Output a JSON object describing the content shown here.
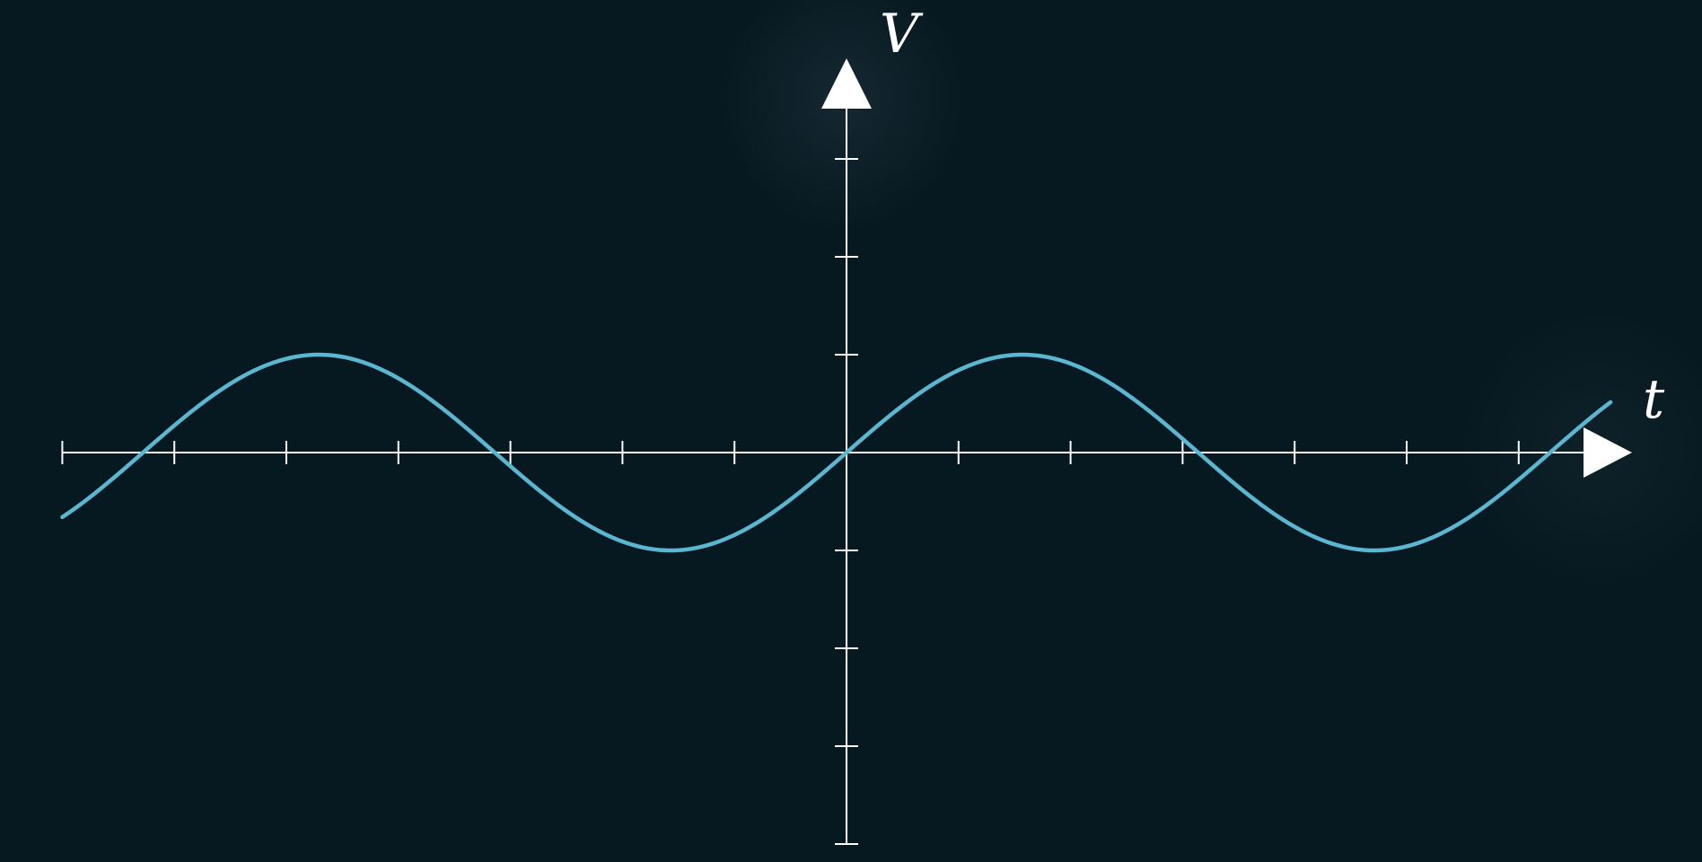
{
  "chart_data": {
    "type": "line",
    "title": "",
    "xlabel": "t",
    "ylabel": "V",
    "xlim": [
      -7,
      6.6
    ],
    "ylim": [
      -4,
      3
    ],
    "x_ticks": [
      -7,
      -6,
      -5,
      -4,
      -3,
      -2,
      -1,
      1,
      2,
      3,
      4,
      5,
      6
    ],
    "y_ticks": [
      -4,
      -3,
      -2,
      -1,
      1,
      2,
      3
    ],
    "grid": false,
    "legend": "none",
    "series": [
      {
        "function": "sin",
        "amplitude": 1,
        "period": 6.28,
        "phase": 0,
        "color": "#5BB7D1",
        "x": [
          -7,
          -6.5,
          -6,
          -5.5,
          -5,
          -4.5,
          -4,
          -3.5,
          -3,
          -2.5,
          -2,
          -1.5,
          -1,
          -0.5,
          0,
          0.5,
          1,
          1.5,
          2,
          2.5,
          3,
          3.5,
          4,
          4.5,
          5,
          5.5,
          6,
          6.5,
          7
        ],
        "y": [
          -0.66,
          -0.22,
          0.28,
          0.71,
          0.96,
          0.98,
          0.76,
          0.35,
          -0.14,
          -0.6,
          -0.91,
          -1.0,
          -0.84,
          -0.48,
          0.0,
          0.48,
          0.84,
          1.0,
          0.91,
          0.6,
          0.14,
          -0.35,
          -0.76,
          -0.98,
          -0.96,
          -0.71,
          -0.28,
          0.22,
          0.66
        ]
      }
    ]
  },
  "colors": {
    "background": "#061820",
    "axes": "#FFFFFF",
    "curve": "#5BB7D1"
  }
}
